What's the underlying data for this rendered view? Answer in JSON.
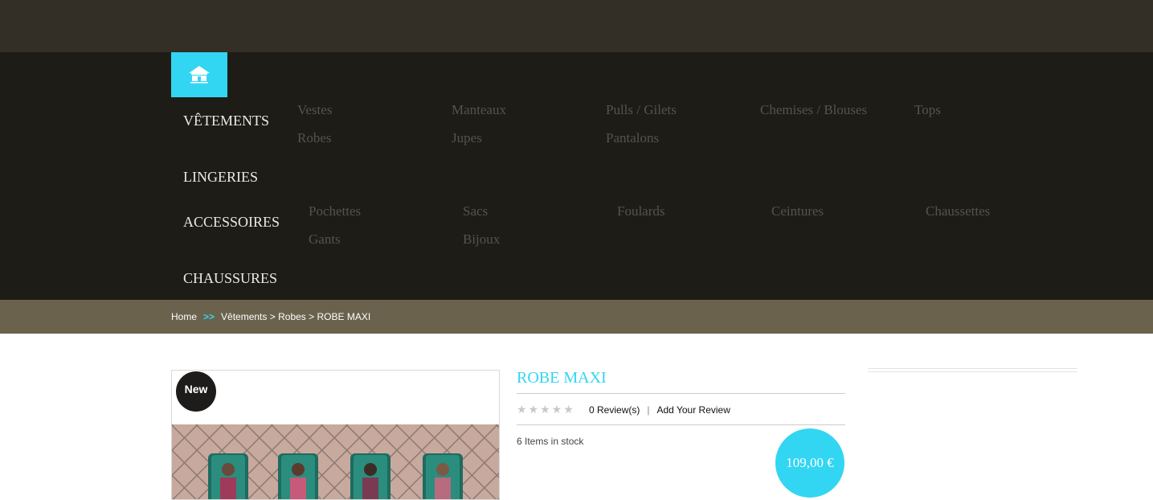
{
  "nav": {
    "categories": [
      {
        "label": "VÊTEMENTS",
        "subs": [
          "Vestes",
          "Manteaux",
          "Pulls / Gilets",
          "Chemises / Blouses",
          "Tops",
          "Robes",
          "Jupes",
          "Pantalons"
        ]
      },
      {
        "label": "LINGERIES",
        "subs": []
      },
      {
        "label": "ACCESSOIRES",
        "subs": [
          "Pochettes",
          "Sacs",
          "Foulards",
          "Ceintures",
          "Chaussettes",
          "Gants",
          "Bijoux"
        ]
      },
      {
        "label": "CHAUSSURES",
        "subs": []
      }
    ]
  },
  "breadcrumb": {
    "home": "Home",
    "separator": ">>",
    "path": [
      "Vêtements",
      "Robes",
      "ROBE MAXI"
    ],
    "divider": ">"
  },
  "product": {
    "badge": "New",
    "title": "ROBE MAXI",
    "rating_stars": "★★★★★",
    "reviews": "0 Review(s)",
    "review_divider": "|",
    "add_review": "Add Your Review",
    "stock": "6 Items in stock",
    "price": "109,00 €"
  },
  "colors": {
    "accent": "#32d6f2",
    "topbar": "#332f27",
    "nav": "#1e1c17",
    "breadcrumb_bar": "#6a624d"
  }
}
